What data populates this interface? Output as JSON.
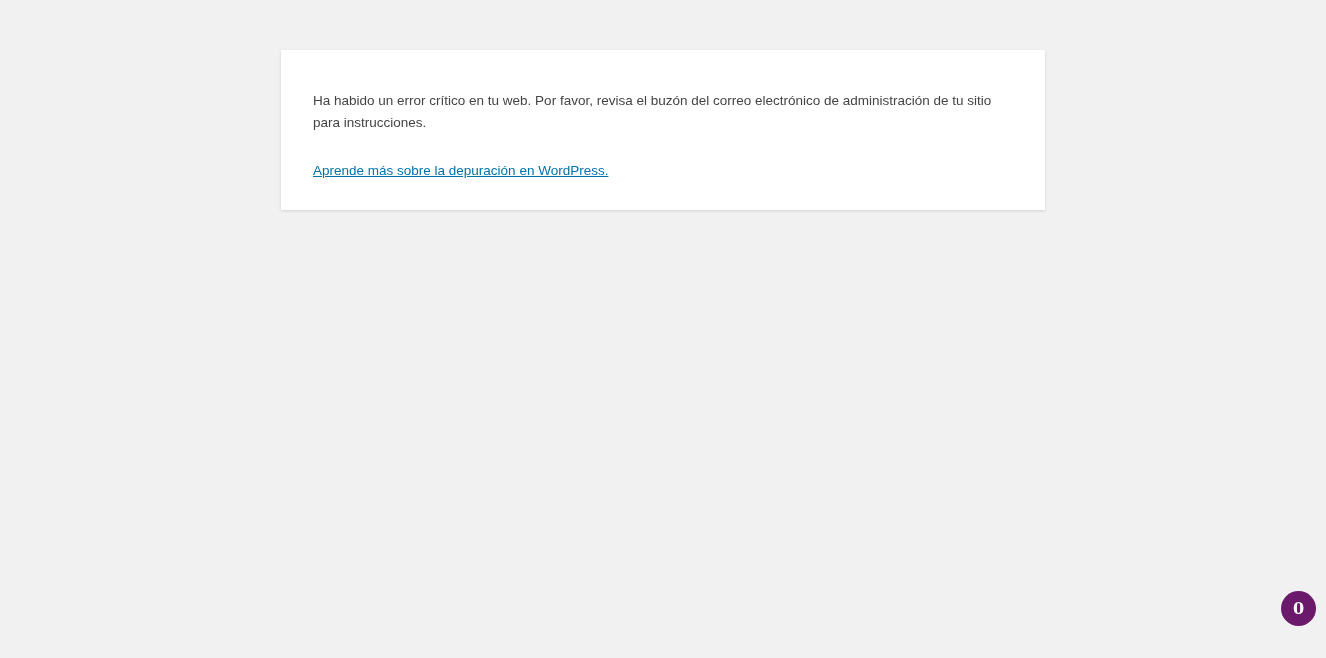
{
  "message": "Ha habido un error crítico en tu web. Por favor, revisa el buzón del correo electrónico de administración de tu sitio para instrucciones.",
  "link": "Aprende más sobre la depuración en WordPress.",
  "counter_badge": "0"
}
